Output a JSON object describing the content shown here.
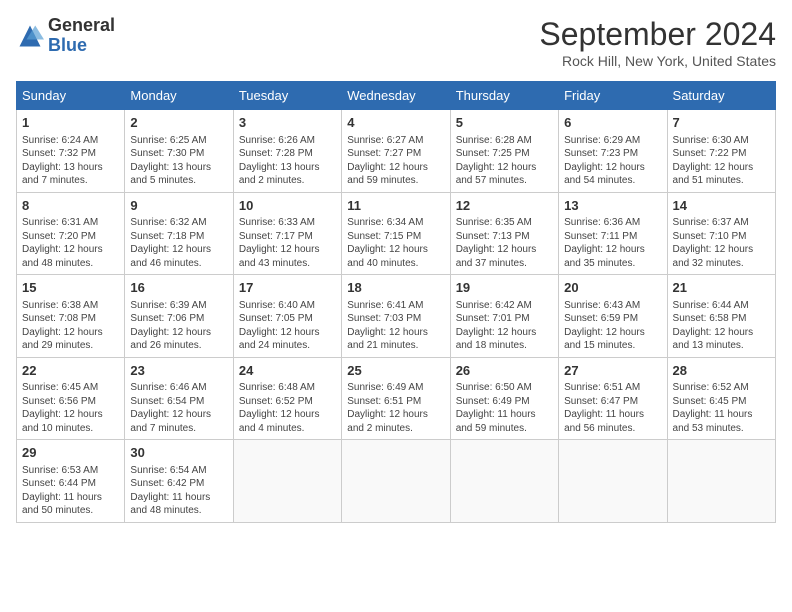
{
  "header": {
    "logo_general": "General",
    "logo_blue": "Blue",
    "month_title": "September 2024",
    "location": "Rock Hill, New York, United States"
  },
  "weekdays": [
    "Sunday",
    "Monday",
    "Tuesday",
    "Wednesday",
    "Thursday",
    "Friday",
    "Saturday"
  ],
  "weeks": [
    [
      {
        "day": 1,
        "info": "Sunrise: 6:24 AM\nSunset: 7:32 PM\nDaylight: 13 hours and 7 minutes."
      },
      {
        "day": 2,
        "info": "Sunrise: 6:25 AM\nSunset: 7:30 PM\nDaylight: 13 hours and 5 minutes."
      },
      {
        "day": 3,
        "info": "Sunrise: 6:26 AM\nSunset: 7:28 PM\nDaylight: 13 hours and 2 minutes."
      },
      {
        "day": 4,
        "info": "Sunrise: 6:27 AM\nSunset: 7:27 PM\nDaylight: 12 hours and 59 minutes."
      },
      {
        "day": 5,
        "info": "Sunrise: 6:28 AM\nSunset: 7:25 PM\nDaylight: 12 hours and 57 minutes."
      },
      {
        "day": 6,
        "info": "Sunrise: 6:29 AM\nSunset: 7:23 PM\nDaylight: 12 hours and 54 minutes."
      },
      {
        "day": 7,
        "info": "Sunrise: 6:30 AM\nSunset: 7:22 PM\nDaylight: 12 hours and 51 minutes."
      }
    ],
    [
      {
        "day": 8,
        "info": "Sunrise: 6:31 AM\nSunset: 7:20 PM\nDaylight: 12 hours and 48 minutes."
      },
      {
        "day": 9,
        "info": "Sunrise: 6:32 AM\nSunset: 7:18 PM\nDaylight: 12 hours and 46 minutes."
      },
      {
        "day": 10,
        "info": "Sunrise: 6:33 AM\nSunset: 7:17 PM\nDaylight: 12 hours and 43 minutes."
      },
      {
        "day": 11,
        "info": "Sunrise: 6:34 AM\nSunset: 7:15 PM\nDaylight: 12 hours and 40 minutes."
      },
      {
        "day": 12,
        "info": "Sunrise: 6:35 AM\nSunset: 7:13 PM\nDaylight: 12 hours and 37 minutes."
      },
      {
        "day": 13,
        "info": "Sunrise: 6:36 AM\nSunset: 7:11 PM\nDaylight: 12 hours and 35 minutes."
      },
      {
        "day": 14,
        "info": "Sunrise: 6:37 AM\nSunset: 7:10 PM\nDaylight: 12 hours and 32 minutes."
      }
    ],
    [
      {
        "day": 15,
        "info": "Sunrise: 6:38 AM\nSunset: 7:08 PM\nDaylight: 12 hours and 29 minutes."
      },
      {
        "day": 16,
        "info": "Sunrise: 6:39 AM\nSunset: 7:06 PM\nDaylight: 12 hours and 26 minutes."
      },
      {
        "day": 17,
        "info": "Sunrise: 6:40 AM\nSunset: 7:05 PM\nDaylight: 12 hours and 24 minutes."
      },
      {
        "day": 18,
        "info": "Sunrise: 6:41 AM\nSunset: 7:03 PM\nDaylight: 12 hours and 21 minutes."
      },
      {
        "day": 19,
        "info": "Sunrise: 6:42 AM\nSunset: 7:01 PM\nDaylight: 12 hours and 18 minutes."
      },
      {
        "day": 20,
        "info": "Sunrise: 6:43 AM\nSunset: 6:59 PM\nDaylight: 12 hours and 15 minutes."
      },
      {
        "day": 21,
        "info": "Sunrise: 6:44 AM\nSunset: 6:58 PM\nDaylight: 12 hours and 13 minutes."
      }
    ],
    [
      {
        "day": 22,
        "info": "Sunrise: 6:45 AM\nSunset: 6:56 PM\nDaylight: 12 hours and 10 minutes."
      },
      {
        "day": 23,
        "info": "Sunrise: 6:46 AM\nSunset: 6:54 PM\nDaylight: 12 hours and 7 minutes."
      },
      {
        "day": 24,
        "info": "Sunrise: 6:48 AM\nSunset: 6:52 PM\nDaylight: 12 hours and 4 minutes."
      },
      {
        "day": 25,
        "info": "Sunrise: 6:49 AM\nSunset: 6:51 PM\nDaylight: 12 hours and 2 minutes."
      },
      {
        "day": 26,
        "info": "Sunrise: 6:50 AM\nSunset: 6:49 PM\nDaylight: 11 hours and 59 minutes."
      },
      {
        "day": 27,
        "info": "Sunrise: 6:51 AM\nSunset: 6:47 PM\nDaylight: 11 hours and 56 minutes."
      },
      {
        "day": 28,
        "info": "Sunrise: 6:52 AM\nSunset: 6:45 PM\nDaylight: 11 hours and 53 minutes."
      }
    ],
    [
      {
        "day": 29,
        "info": "Sunrise: 6:53 AM\nSunset: 6:44 PM\nDaylight: 11 hours and 50 minutes."
      },
      {
        "day": 30,
        "info": "Sunrise: 6:54 AM\nSunset: 6:42 PM\nDaylight: 11 hours and 48 minutes."
      },
      null,
      null,
      null,
      null,
      null
    ]
  ]
}
